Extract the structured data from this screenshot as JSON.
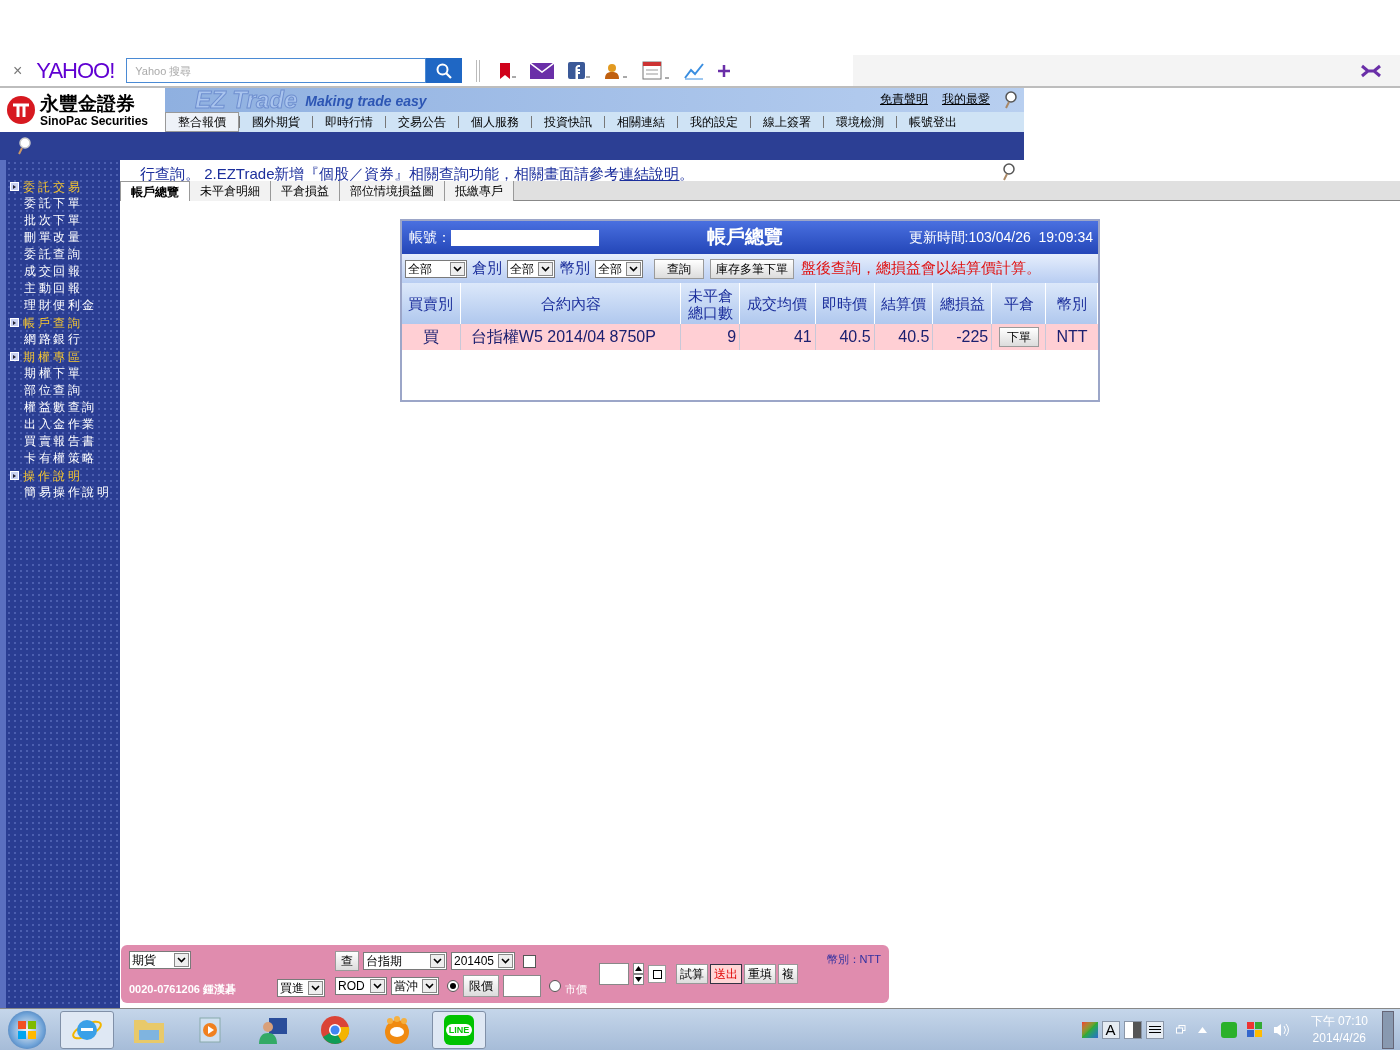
{
  "browser_toolbar": {
    "close": "×",
    "logo": "YAHOO!",
    "search_placeholder": "Yahoo 搜尋"
  },
  "header": {
    "brand_cn": "永豐金證券",
    "brand_en": "SinoPac Securities",
    "banner_title": "EZ Trade",
    "banner_slogan": "Making trade easy",
    "links": [
      "免責聲明",
      "我的最愛"
    ],
    "nav": [
      {
        "label": "整合報價",
        "selected": true
      },
      {
        "label": "國外期貨",
        "selected": false
      },
      {
        "label": "即時行情",
        "selected": false
      },
      {
        "label": "交易公告",
        "selected": false
      },
      {
        "label": "個人服務",
        "selected": false
      },
      {
        "label": "投資快訊",
        "selected": false
      },
      {
        "label": "相關連結",
        "selected": false
      },
      {
        "label": "我的設定",
        "selected": false
      },
      {
        "label": "線上簽署",
        "selected": false
      },
      {
        "label": "環境檢測",
        "selected": false
      },
      {
        "label": "帳號登出",
        "selected": false
      }
    ]
  },
  "notice": {
    "before": "行查詢。 2.EZTrade新增『個股／資券』相關查詢功能，相關畫面請參考",
    "link": "連結說明",
    "after": "。"
  },
  "sidebar": [
    {
      "label": "委託交易",
      "children": [
        {
          "label": "委託下單"
        },
        {
          "label": "批次下單"
        },
        {
          "label": "刪單改量"
        },
        {
          "label": "委託查詢"
        },
        {
          "label": "成交回報"
        },
        {
          "label": "主動回報"
        },
        {
          "label": "理財便利金"
        }
      ]
    },
    {
      "label": "帳戶查詢",
      "children": [
        {
          "label": "網路銀行"
        }
      ]
    },
    {
      "label": "期權專區",
      "children": [
        {
          "label": "期權下單"
        },
        {
          "label": "部位查詢"
        },
        {
          "label": "權益數查詢"
        },
        {
          "label": "出入金作業"
        },
        {
          "label": "買賣報告書"
        },
        {
          "label": "卡有權策略"
        }
      ]
    },
    {
      "label": "操作說明",
      "children": [
        {
          "label": "簡易操作說明"
        }
      ]
    }
  ],
  "tabs": [
    {
      "label": "帳戶總覽",
      "selected": true
    },
    {
      "label": "未平倉明細",
      "selected": false
    },
    {
      "label": "平倉損益",
      "selected": false
    },
    {
      "label": "部位情境損益圖",
      "selected": false
    },
    {
      "label": "抵繳專戶",
      "selected": false
    }
  ],
  "panel": {
    "account_label": "帳號：",
    "title": "帳戶總覽",
    "updated": "更新時間:103/04/26  19:09:34",
    "type_filter": "全部",
    "filters": [
      {
        "label": "倉別",
        "value": "全部"
      },
      {
        "label": "幣別",
        "value": "全部"
      }
    ],
    "buttons": [
      "查詢",
      "庫存多筆下單"
    ],
    "note": "盤後查詢，總損益會以結算價計算。",
    "columns": [
      "買賣別",
      "合約內容",
      "未平倉總口數",
      "成交均價",
      "即時價",
      "結算價",
      "總損益",
      "平倉",
      "幣別"
    ],
    "rows": [
      {
        "side": "買",
        "contract": "台指權W5 2014/04 8750P",
        "open_qty": "9",
        "avg_price": "41",
        "last_price": "40.5",
        "settle_price": "40.5",
        "pnl": "-225",
        "action": "下單",
        "currency": "NTT"
      }
    ]
  },
  "order_bar": {
    "product": "期貨",
    "account": "0020-0761206 鍾漢碁",
    "query_button": "查",
    "contract": "台指期",
    "month": "201405",
    "month_checked": false,
    "side": "買進",
    "order_type": "ROD",
    "day_trade": "當沖",
    "price_modes": [
      {
        "label": "限價",
        "selected": true
      },
      {
        "label": "市價",
        "selected": false
      }
    ],
    "buttons": [
      {
        "label": "試算",
        "primary": false
      },
      {
        "label": "送出",
        "primary": true
      },
      {
        "label": "重填",
        "primary": false
      },
      {
        "label": "複",
        "primary": false
      }
    ],
    "currency": "幣別：NTT"
  },
  "taskbar": {
    "apps": [
      {
        "kind": "ie",
        "active": true
      },
      {
        "kind": "folder",
        "active": false
      },
      {
        "kind": "media",
        "active": false
      },
      {
        "kind": "person",
        "active": false
      },
      {
        "kind": "chrome",
        "active": false
      },
      {
        "kind": "player",
        "active": false
      },
      {
        "kind": "line",
        "active": true,
        "label": "LINE"
      }
    ],
    "ime": "A",
    "time": "下午 07:10",
    "date": "2014/4/26"
  }
}
